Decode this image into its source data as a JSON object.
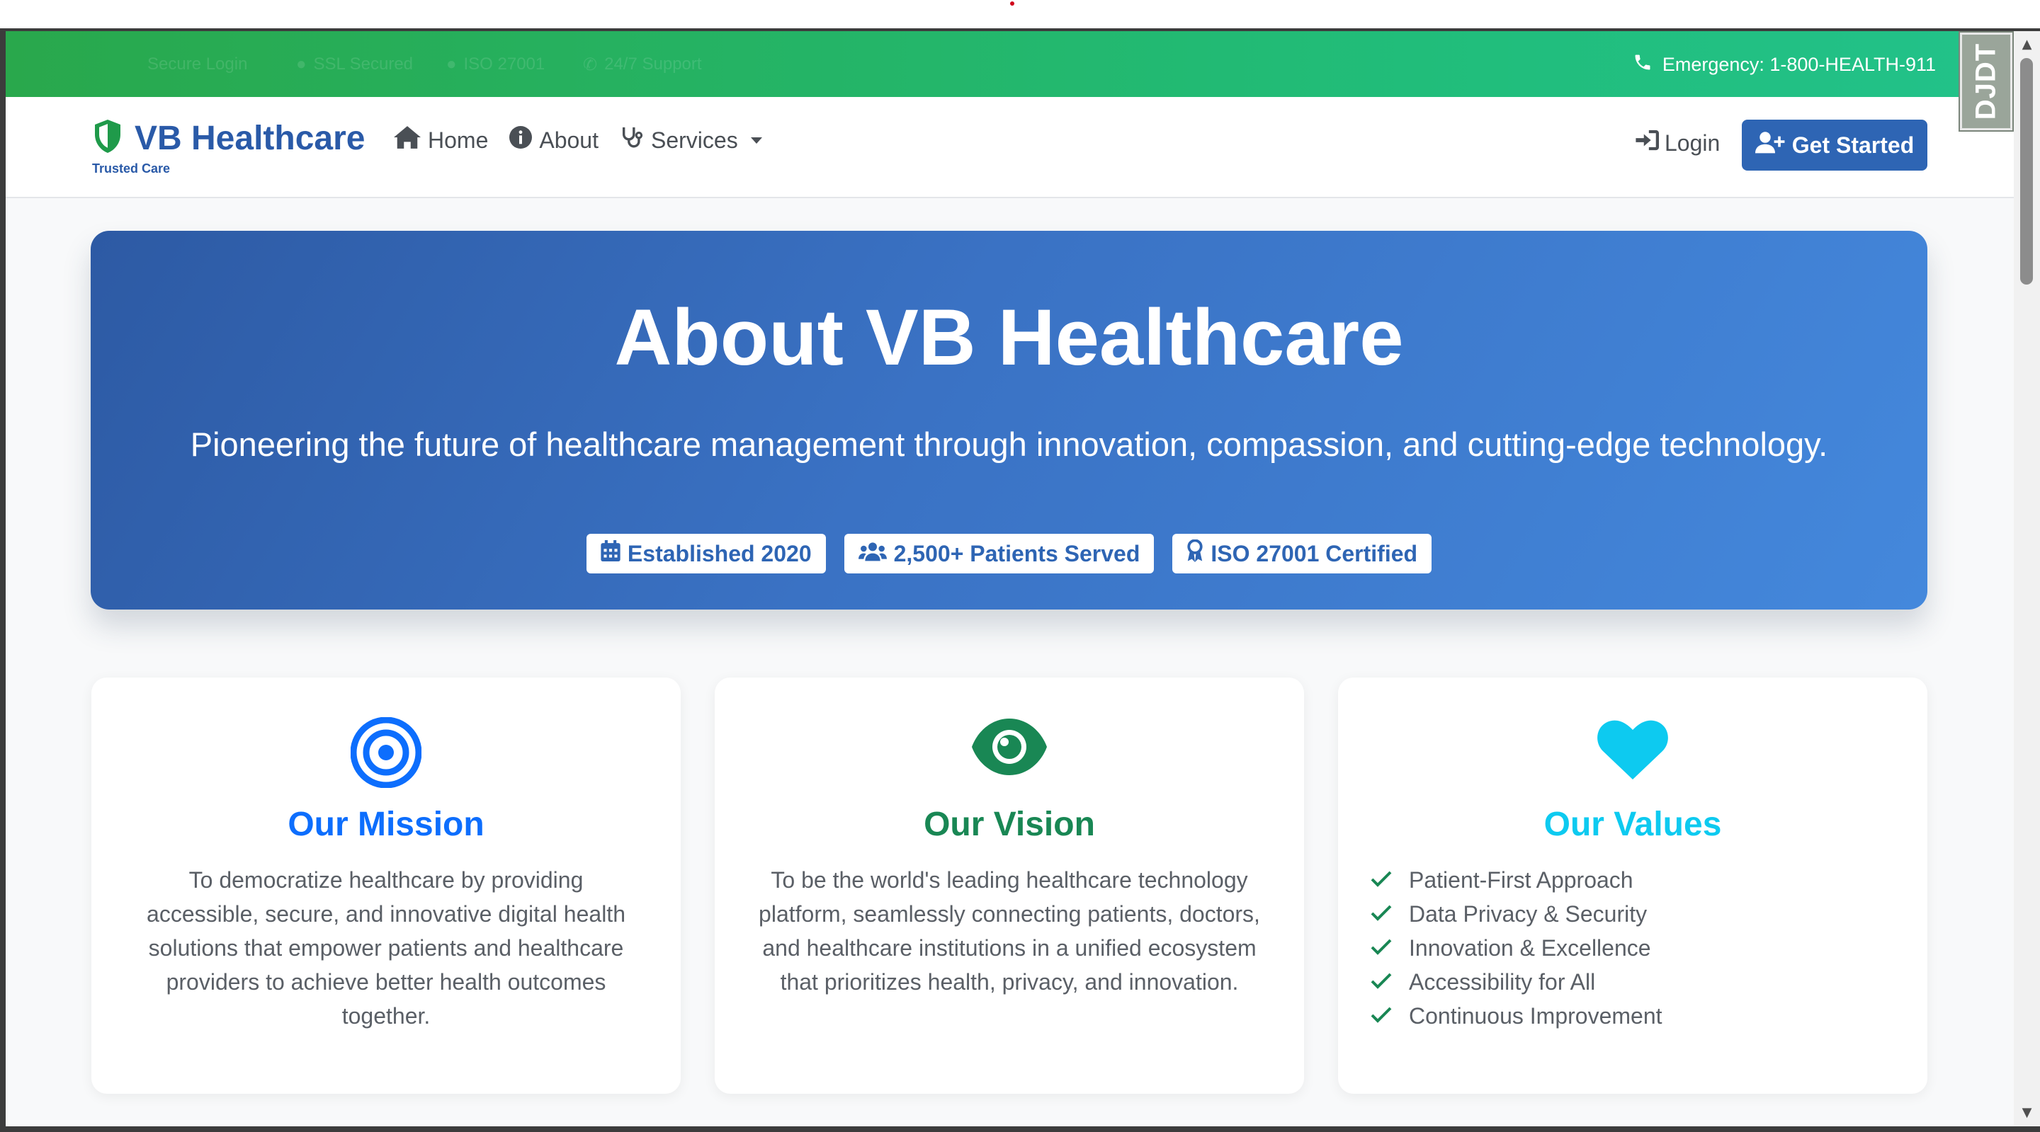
{
  "topbar": {
    "faded_items": [
      "Secure Login",
      "SSL Secured",
      "ISO 27001",
      "24/7 Support"
    ],
    "emergency": "Emergency: 1-800-HEALTH-911"
  },
  "ext_badge": "DJDT",
  "brand": {
    "name": "VB Healthcare",
    "tagline": "Trusted Care"
  },
  "nav": {
    "home": "Home",
    "about": "About",
    "services": "Services",
    "login": "Login",
    "get_started": "Get Started"
  },
  "hero": {
    "title": "About VB Healthcare",
    "subtitle": "Pioneering the future of healthcare management through innovation, compassion, and cutting-edge technology.",
    "badges": [
      "Established 2020",
      "2,500+ Patients Served",
      "ISO 27001 Certified"
    ]
  },
  "cards": {
    "mission": {
      "title": "Our Mission",
      "text": "To democratize healthcare by providing accessible, secure, and innovative digital health solutions that empower patients and healthcare providers to achieve better health outcomes together.",
      "color": "#0d6efd"
    },
    "vision": {
      "title": "Our Vision",
      "text": "To be the world's leading healthcare technology platform, seamlessly connecting patients, doctors, and healthcare institutions in a unified ecosystem that prioritizes health, privacy, and innovation.",
      "color": "#198754"
    },
    "values": {
      "title": "Our Values",
      "items": [
        "Patient-First Approach",
        "Data Privacy & Security",
        "Innovation & Excellence",
        "Accessibility for All",
        "Continuous Improvement"
      ],
      "color": "#0dcaf0"
    }
  },
  "colors": {
    "brand": "#2a5aa8",
    "topbar_start": "#29a84c",
    "topbar_end": "#22c28a",
    "check": "#198754"
  }
}
